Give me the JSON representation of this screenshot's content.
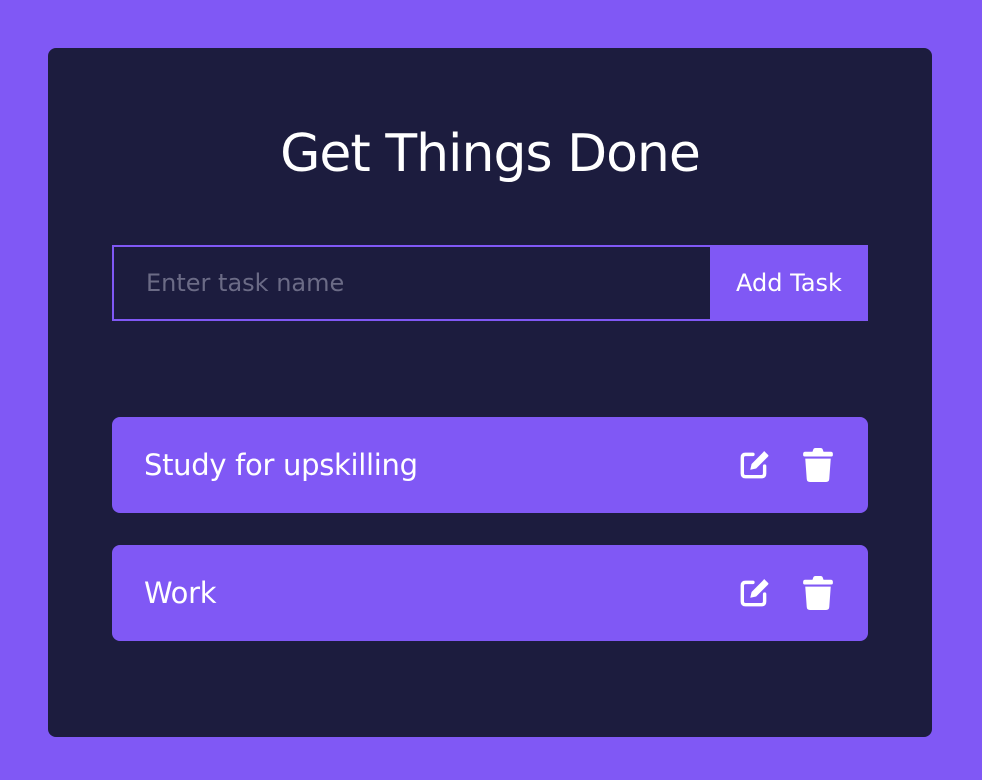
{
  "app": {
    "title": "Get Things Done"
  },
  "form": {
    "input_value": "",
    "input_placeholder": "Enter task name",
    "add_label": "Add Task"
  },
  "tasks": [
    {
      "label": "Study for upskilling",
      "edit_icon": "edit-icon",
      "delete_icon": "trash-icon"
    },
    {
      "label": "Work",
      "edit_icon": "edit-icon",
      "delete_icon": "trash-icon"
    }
  ],
  "colors": {
    "background": "#8058f5",
    "card": "#1c1c3e",
    "accent": "#8058f5",
    "text": "#ffffff",
    "placeholder": "#6b6b86"
  }
}
